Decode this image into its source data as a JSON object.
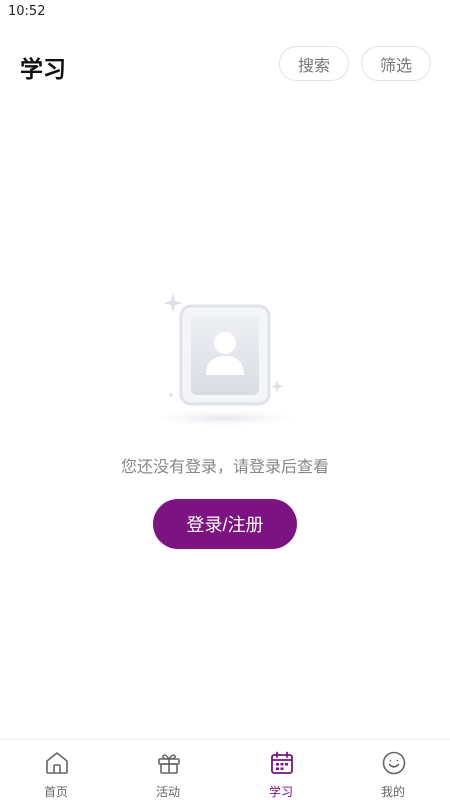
{
  "status_bar": {
    "time": "10:52"
  },
  "header": {
    "title": "学习",
    "search_label": "搜索",
    "filter_label": "筛选"
  },
  "empty_state": {
    "message": "您还没有登录，请登录后查看",
    "login_button": "登录/注册"
  },
  "bottom_nav": {
    "active": "学习",
    "items": [
      {
        "label": "首页",
        "icon": "home-icon"
      },
      {
        "label": "活动",
        "icon": "gift-icon"
      },
      {
        "label": "学习",
        "icon": "calendar-icon"
      },
      {
        "label": "我的",
        "icon": "smiley-icon"
      }
    ]
  },
  "colors": {
    "accent": "#7d1281",
    "text_muted": "#888888",
    "nav_inactive": "#666666",
    "border": "#e2e2e2"
  }
}
